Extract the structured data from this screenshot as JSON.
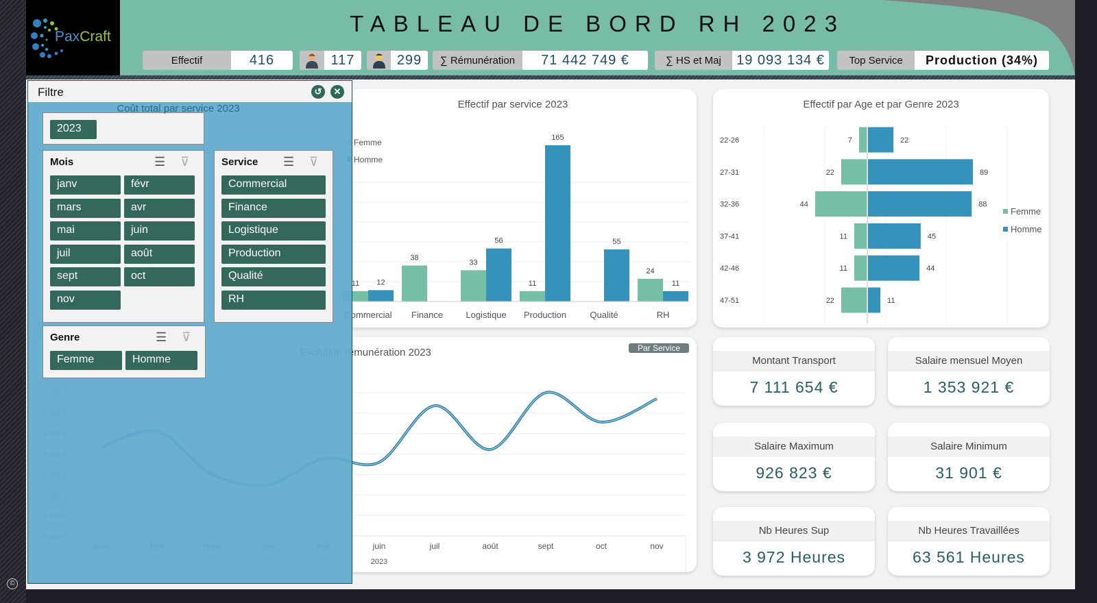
{
  "header": {
    "title": "TABLEAU DE BORD RH 2023",
    "logo_text_a": "Pax",
    "logo_text_b": "Craft"
  },
  "kpis_top": {
    "effectif_label": "Effectif",
    "effectif_value": "416",
    "femme_value": "117",
    "homme_value": "299",
    "remuneration_label": "∑ Rémunération",
    "remuneration_value": "71 442 749 €",
    "hs_label": "∑ HS et Maj",
    "hs_value": "19 093 134 €",
    "top_service_label": "Top Service",
    "top_service_value": "Production (34%)"
  },
  "hidden_card": {
    "title": "Coût total par service 2023"
  },
  "kpi_cards": [
    {
      "label": "Montant Transport",
      "value": "7 111 654 €"
    },
    {
      "label": "Salaire mensuel Moyen",
      "value": "1 353 921 €"
    },
    {
      "label": "Salaire Maximum",
      "value": "926 823 €"
    },
    {
      "label": "Salaire Minimum",
      "value": "31 901 €"
    },
    {
      "label": "Nb Heures Sup",
      "value": "3 972 Heures"
    },
    {
      "label": "Nb Heures Travaillées",
      "value": "63 561 Heures"
    }
  ],
  "filter": {
    "title": "Filtre",
    "year": "2023",
    "mois_label": "Mois",
    "mois": [
      "janv",
      "févr",
      "mars",
      "avr",
      "mai",
      "juin",
      "juil",
      "août",
      "sept",
      "oct",
      "nov"
    ],
    "service_label": "Service",
    "services": [
      "Commercial",
      "Finance",
      "Logistique",
      "Production",
      "Qualité",
      "RH"
    ],
    "genre_label": "Genre",
    "genres": [
      "Femme",
      "Homme"
    ]
  },
  "par_service_button": "Par Service",
  "copyright": "©",
  "colors": {
    "femme": "#76bfa7",
    "homme": "#3592bb",
    "slicer": "#33685a",
    "header": "#76bca6"
  },
  "chart_data": [
    {
      "type": "bar",
      "title": "Effectif par service 2023",
      "categories": [
        "Commercial",
        "Finance",
        "Logistique",
        "Production",
        "Qualité",
        "RH"
      ],
      "series": [
        {
          "name": "Femme",
          "values": [
            11,
            38,
            33,
            11,
            0,
            24
          ]
        },
        {
          "name": "Homme",
          "values": [
            12,
            0,
            56,
            165,
            55,
            11
          ]
        }
      ],
      "legend": "top-left",
      "data_labels": true
    },
    {
      "type": "bar",
      "orientation": "horizontal",
      "title": "Effectif par Age et par Genre 2023",
      "categories": [
        "22-26",
        "27-31",
        "32-36",
        "37-41",
        "42-46",
        "47-51"
      ],
      "series": [
        {
          "name": "Femme",
          "values": [
            7,
            22,
            44,
            11,
            11,
            22
          ]
        },
        {
          "name": "Homme",
          "values": [
            22,
            89,
            88,
            45,
            44,
            11
          ]
        }
      ],
      "legend": "right",
      "data_labels": true
    },
    {
      "type": "line",
      "title": "Evolution rémunération 2023",
      "categories": [
        "janv",
        "févr",
        "mars",
        "avr",
        "mai",
        "juin",
        "juil",
        "août",
        "sept",
        "oct",
        "nov"
      ],
      "xlabel": "2023",
      "values": [
        6433,
        6511,
        6300,
        6250,
        6378,
        6360,
        6636,
        6422,
        6700,
        6556,
        6670
      ],
      "yticks": [
        "6 000 K",
        "6 100 K",
        "6 200 K",
        "6 300 K",
        "6 400 K",
        "6 500 K",
        "6 600 K",
        "6 700 K"
      ],
      "ylim": [
        6000,
        6700
      ],
      "grid": true,
      "smooth": true
    }
  ]
}
